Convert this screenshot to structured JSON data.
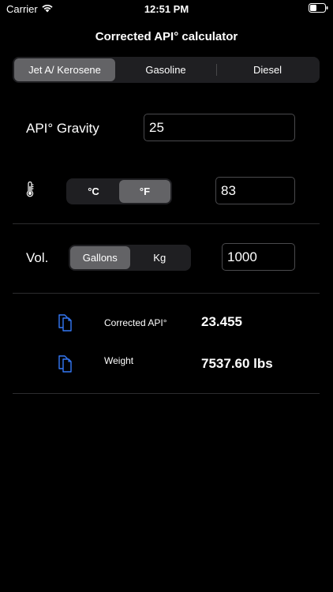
{
  "status_bar": {
    "carrier": "Carrier",
    "time": "12:51 PM",
    "wifi_icon": "wifi-icon",
    "battery_icon": "battery-icon"
  },
  "title": "Corrected API° calculator",
  "fuel_types": {
    "options": [
      "Jet A/ Kerosene",
      "Gasoline",
      "Diesel"
    ],
    "selected": "Jet A/ Kerosene"
  },
  "api_gravity": {
    "label": "API° Gravity",
    "value": "25"
  },
  "temperature": {
    "icon": "thermometer-icon",
    "units": [
      "°C",
      "°F"
    ],
    "selected_unit": "°F",
    "value": "83"
  },
  "volume": {
    "label": "Vol.",
    "units": [
      "Gallons",
      "Kg"
    ],
    "selected_unit": "Gallons",
    "value": "1000"
  },
  "results": [
    {
      "icon": "copy-icon",
      "label": "Corrected API°",
      "value": "23.455"
    },
    {
      "icon": "copy-icon",
      "label": "Weight",
      "value": "7537.60 lbs"
    }
  ],
  "colors": {
    "background": "#000000",
    "segment_bg": "#1f1f22",
    "segment_selected": "#636366",
    "accent_blue": "#3478f6",
    "field_border": "#4a4a4d"
  }
}
